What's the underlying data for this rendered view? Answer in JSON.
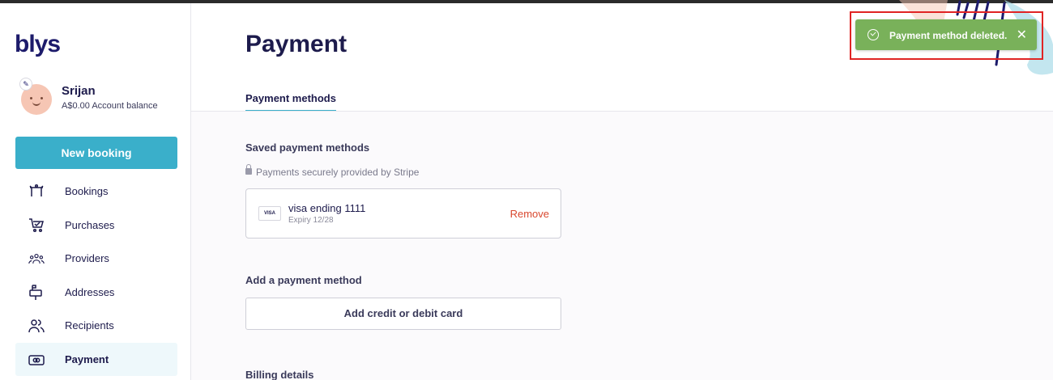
{
  "app": {
    "logo": "blys"
  },
  "user": {
    "name": "Srijan",
    "balance": "A$0.00 Account balance"
  },
  "sidebar": {
    "new_booking_label": "New booking",
    "items": [
      {
        "label": "Bookings",
        "icon": "massage-table-icon",
        "active": false
      },
      {
        "label": "Purchases",
        "icon": "cart-icon",
        "active": false
      },
      {
        "label": "Providers",
        "icon": "group-icon",
        "active": false
      },
      {
        "label": "Addresses",
        "icon": "mailbox-icon",
        "active": false
      },
      {
        "label": "Recipients",
        "icon": "people-icon",
        "active": false
      },
      {
        "label": "Payment",
        "icon": "payment-card-icon",
        "active": true
      }
    ]
  },
  "main": {
    "title": "Payment",
    "tabs": [
      {
        "label": "Payment methods",
        "active": true
      }
    ],
    "saved_title": "Saved payment methods",
    "stripe_note": "Payments securely provided by Stripe",
    "card": {
      "brand": "VISA",
      "name": "visa ending 1111",
      "expiry": "Expiry 12/28",
      "remove_label": "Remove"
    },
    "add_title": "Add a payment method",
    "add_button_label": "Add credit or debit card",
    "billing_title": "Billing details"
  },
  "toast": {
    "message": "Payment method deleted.",
    "close_symbol": "✕",
    "color": "#79b15a"
  },
  "colors": {
    "accent": "#3aafca",
    "brand": "#1d1b6b",
    "danger": "#d9482f"
  }
}
